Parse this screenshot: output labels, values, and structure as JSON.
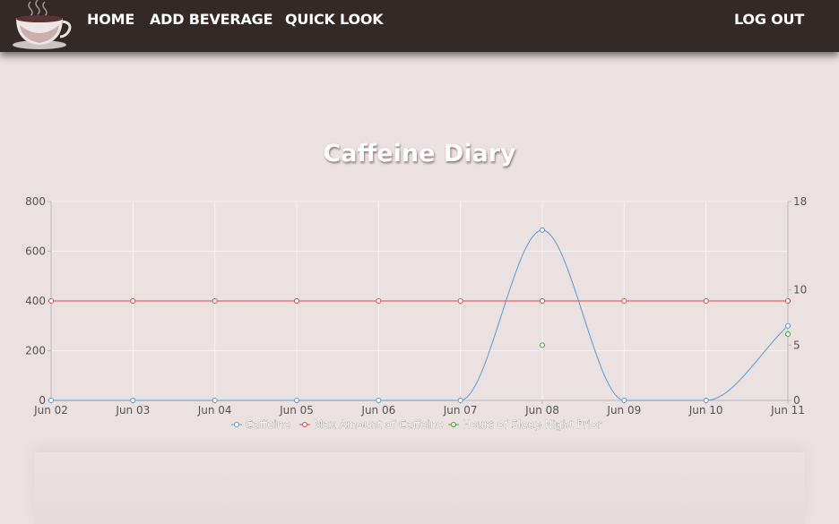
{
  "nav": {
    "home": "HOME",
    "add_beverage": "ADD BEVERAGE",
    "quick_look": "QUICK LOOK",
    "logout": "LOG OUT"
  },
  "colors": {
    "navbar": "#342927",
    "background": "#ebe1e0",
    "caffeine": "#5b9bd5",
    "max": "#e34848",
    "sleep": "#3aab3a"
  },
  "icons": {
    "logo": "coffee-cup-icon"
  },
  "chart_data": {
    "type": "line",
    "title": "Caffeine Diary",
    "categories": [
      "Jun 02",
      "Jun 03",
      "Jun 04",
      "Jun 05",
      "Jun 06",
      "Jun 07",
      "Jun 08",
      "Jun 09",
      "Jun 10",
      "Jun 11"
    ],
    "y_left": {
      "ylim": [
        0,
        800
      ],
      "ticks": [
        0,
        200,
        400,
        600,
        800
      ]
    },
    "y_right": {
      "ylim": [
        0,
        18
      ],
      "ticks": [
        0,
        5,
        10,
        18
      ]
    },
    "grid": true,
    "legend_position": "bottom",
    "series": [
      {
        "name": "Caffeine",
        "axis": "left",
        "smooth": true,
        "values": [
          0,
          0,
          0,
          0,
          0,
          0,
          685,
          0,
          0,
          300
        ]
      },
      {
        "name": "Max Amount of Caffeine",
        "axis": "left",
        "smooth": false,
        "values": [
          400,
          400,
          400,
          400,
          400,
          400,
          400,
          400,
          400,
          400
        ]
      },
      {
        "name": "Hours of Sleep Night Prior",
        "axis": "right",
        "smooth": false,
        "values": [
          null,
          null,
          null,
          null,
          null,
          null,
          5,
          null,
          null,
          6
        ]
      }
    ]
  }
}
